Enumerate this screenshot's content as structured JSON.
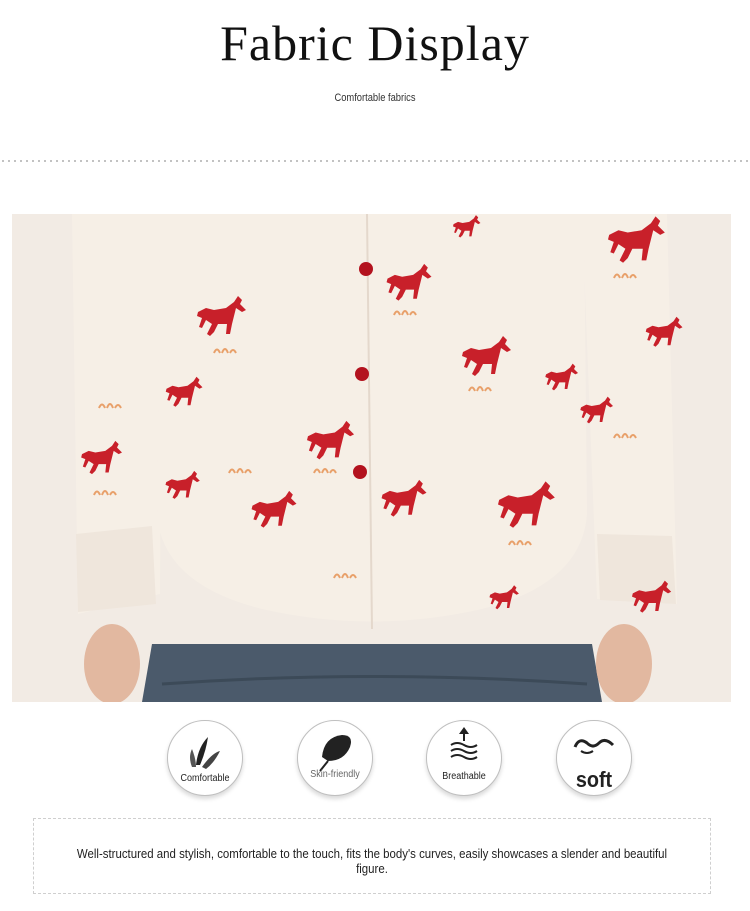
{
  "header": {
    "title": "Fabric  Display",
    "subtitle": "Comfortable fabrics"
  },
  "photo": {
    "alt": "model-shirt-photo",
    "colors": {
      "fabric": "#f6efe6",
      "horse": "#c8202a",
      "grass": "#e8a06a",
      "denim": "#4b5a6b",
      "background": "#f2ebe4"
    }
  },
  "features": [
    {
      "label": "Comfortable",
      "icon": "leaf-icon"
    },
    {
      "label": "Skin-friendly",
      "icon": "feather-icon"
    },
    {
      "label": "Breathable",
      "icon": "wave-arrow-icon"
    },
    {
      "label": "soft",
      "icon": "swirl-icon"
    }
  ],
  "description": "Well-structured and stylish, comfortable to the touch, fits the body's curves, easily showcases a slender and beautiful figure."
}
